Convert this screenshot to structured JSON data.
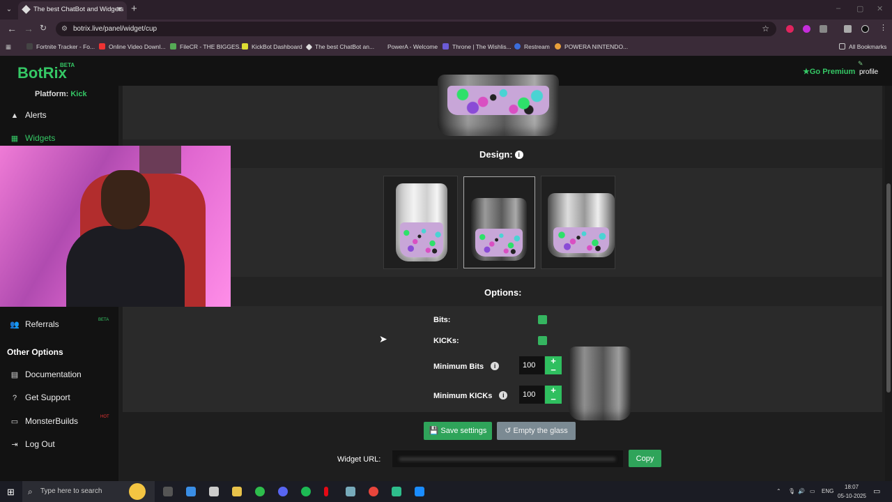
{
  "browser": {
    "tab_title": "The best ChatBot and Widgets",
    "tab_close": "✕",
    "new_tab": "+",
    "url": "botrix.live/panel/widget/cup",
    "bookmarks": [
      {
        "label": "Fortnite Tracker - Fo...",
        "color": "#444"
      },
      {
        "label": "Online Video Downl...",
        "color": "#e33"
      },
      {
        "label": "FileCR - THE BIGGES...",
        "color": "#5a5"
      },
      {
        "label": "KickBot Dashboard",
        "color": "#dd3"
      },
      {
        "label": "The best ChatBot an...",
        "color": "#ddd"
      },
      {
        "label": "PowerA - Welcome",
        "color": "#3a2b38"
      },
      {
        "label": "Throne | The Wishlis...",
        "color": "#6b5bd6"
      },
      {
        "label": "Restream",
        "color": "#3b6ddb"
      },
      {
        "label": "POWERA NINTENDO...",
        "color": "#e8a03a"
      }
    ],
    "all_bookmarks": "All Bookmarks"
  },
  "app": {
    "logo": "BotRix",
    "logo_badge": "BETA",
    "premium": "Go Premium",
    "profile": "profile"
  },
  "sidebar": {
    "platform_label": "Platform:",
    "platform_value": "Kick",
    "items": [
      {
        "label": "Alerts",
        "icon": "warning-icon"
      },
      {
        "label": "Widgets",
        "icon": "grid-icon"
      },
      {
        "label": "Referrals",
        "icon": "users-icon",
        "badge": "BETA"
      }
    ],
    "other_title": "Other Options",
    "other_items": [
      {
        "label": "Documentation",
        "icon": "book-icon"
      },
      {
        "label": "Get Support",
        "icon": "question-icon"
      },
      {
        "label": "MonsterBuilds",
        "icon": "laptop-icon",
        "badge": "HOT"
      },
      {
        "label": "Log Out",
        "icon": "logout-icon"
      }
    ]
  },
  "design": {
    "title": "Design:",
    "selected_index": 1
  },
  "options": {
    "title": "Options:",
    "bits_label": "Bits:",
    "kicks_label": "KICKs:",
    "min_bits_label": "Minimum Bits",
    "min_bits_value": "100",
    "min_kicks_label": "Minimum KICKs",
    "min_kicks_value": "100"
  },
  "actions": {
    "save": "Save settings",
    "empty": "Empty the glass"
  },
  "widget_url": {
    "label": "Widget URL:",
    "copy": "Copy"
  },
  "taskbar": {
    "search_placeholder": "Type here to search",
    "lang": "ENG",
    "time": "18:07",
    "date": "05-10-2025"
  },
  "colors": {
    "accent": "#35c765",
    "button_green": "#2fa45a",
    "button_gray": "#7b8a93"
  }
}
